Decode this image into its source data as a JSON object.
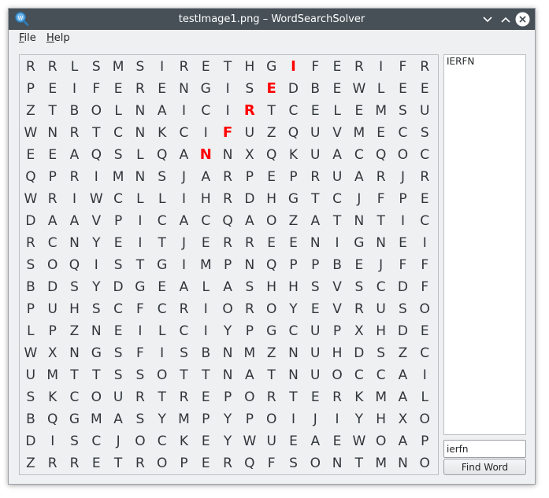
{
  "window": {
    "title": "testImage1.png – WordSearchSolver"
  },
  "icons": {
    "app": "magnifier-app-icon",
    "minimize": "chevron-down-icon",
    "maximize": "chevron-up-icon",
    "close": "close-icon"
  },
  "colors": {
    "titlebar": "#475057",
    "highlight": "#ff0000",
    "close_button": "#ffffff"
  },
  "menu": [
    {
      "label": "File",
      "mnemonic": "F",
      "rest": "ile"
    },
    {
      "label": "Help",
      "mnemonic": "H",
      "rest": "elp"
    }
  ],
  "grid": {
    "rows": [
      "RRLSMSIRETHGIFERIFR",
      "PEIFERENGISEDBEWLEE",
      "ZTBOLNAICIRTCELEMSU",
      "WNRTCNKCIFUZQUVMECS",
      "EEAQSLQANNXQKUACQOC",
      "QPRIMNSJARPEPRUARJR",
      "WRIWCLLIHRDHGTCJFPE",
      "DAAVPICACQAOZATNTIC",
      "RCNYEITJERREENIGNEI",
      "SOQISTGIMPNQPPBEJFF",
      "BDSYDGEALASHHSVSCDF",
      "PUHSCFCRIOROYEVRUSO",
      "LPZNEILCIYPGCUPXHDE",
      "WXNGSFISBNMZNUHDSZC",
      "UMTTSSOTTNATNUOCCAI",
      "SKCOURTREPORTERKMAL",
      "BQGMASYMPYPOIJIYHXO",
      "DISCJOCKEYWUEAEWOAP",
      "ZRRETROPERQFSONTMNO"
    ],
    "highlighted": [
      [
        0,
        12
      ],
      [
        1,
        11
      ],
      [
        2,
        10
      ],
      [
        3,
        9
      ],
      [
        4,
        8
      ]
    ]
  },
  "results": [
    "IERFN"
  ],
  "search": {
    "value": "ierfn"
  },
  "find_button": {
    "label": "Find Word"
  }
}
